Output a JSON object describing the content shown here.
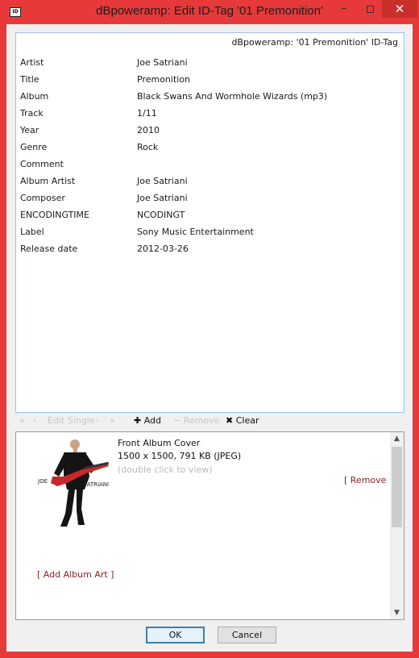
{
  "window": {
    "icon_text": "ID",
    "title": "dBpoweramp: Edit ID-Tag '01 Premonition'",
    "minimize": "–",
    "close": "✕"
  },
  "tag_panel": {
    "header": "dBpoweramp: '01 Premonition' ID-Tag",
    "rows": [
      {
        "name": "Artist",
        "value": "Joe Satriani"
      },
      {
        "name": "Title",
        "value": "Premonition"
      },
      {
        "name": "Album",
        "value": "Black Swans And Wormhole Wizards (mp3)"
      },
      {
        "name": "Track",
        "value": "1/11"
      },
      {
        "name": "Year",
        "value": "2010"
      },
      {
        "name": "Genre",
        "value": "Rock"
      },
      {
        "name": "Comment",
        "value": ""
      },
      {
        "name": "Album Artist",
        "value": "Joe Satriani"
      },
      {
        "name": "Composer",
        "value": "Joe Satriani"
      },
      {
        "name": "ENCODINGTIME",
        "value": "NCODINGT"
      },
      {
        "name": "Label",
        "value": "Sony Music Entertainment"
      },
      {
        "name": "Release date",
        "value": "2012-03-26"
      }
    ]
  },
  "toolbar": {
    "first": "«",
    "prev": "‹",
    "edit_single": "Edit Single",
    "next": "›",
    "last": "»",
    "add": "✚ Add",
    "remove": "− Remove",
    "clear": "✖ Clear"
  },
  "album_art": {
    "title": "Front Album Cover",
    "dimensions": "1500 x 1500, 791 KB  (JPEG)",
    "hint": "(double click to view)",
    "remove_link": "[ Remove ]",
    "add_link": "[ Add Album Art ]",
    "cover_text_left": "JOE",
    "cover_text_right": "SATRIANI"
  },
  "buttons": {
    "ok": "OK",
    "cancel": "Cancel"
  },
  "colors": {
    "frame": "#e8393a",
    "close_button": "#c9302c",
    "link": "#8a1d1d",
    "panel_border": "#9cc4ea"
  }
}
